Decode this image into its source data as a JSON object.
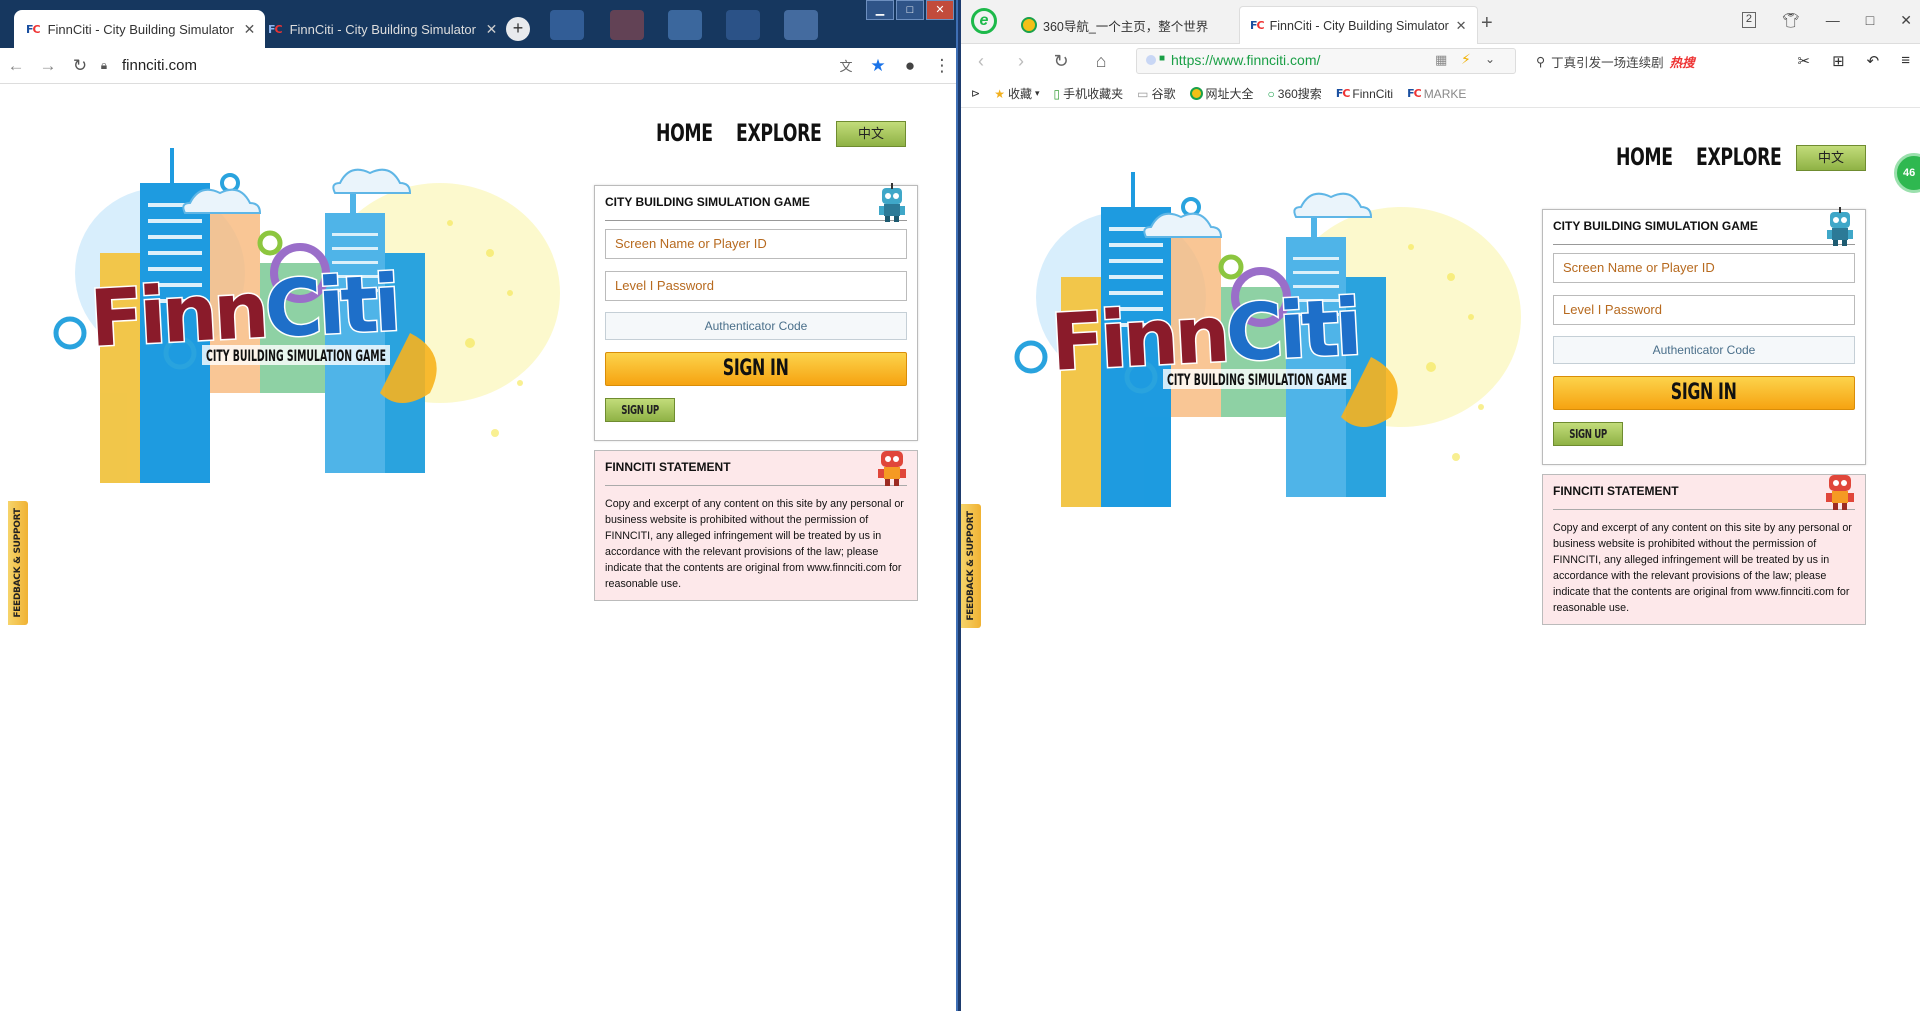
{
  "chrome": {
    "tab1_title": "FinnCiti - City Building Simulator",
    "tab2_title": "FinnCiti - City Building Simulator",
    "url": "finnciti.com",
    "new_tab": "+",
    "win_min": "▁",
    "win_max": "□",
    "win_close": "✕"
  },
  "browser360": {
    "tab1_title": "360导航_一个主页，整个世界",
    "tab2_title": "FinnCiti - City Building Simulator",
    "url": "https://www.finnciti.com/",
    "search_text": "丁真引发一场连续剧",
    "search_hot": "热搜",
    "tab_count": "2",
    "bookmarks": [
      "收藏",
      "手机收藏夹",
      "谷歌",
      "网址大全",
      "360搜索",
      "FinnCiti",
      "MARKE"
    ],
    "side_badge": "46"
  },
  "page": {
    "nav_home": "HOME",
    "nav_explore": "EXPLORE",
    "lang_button": "中文",
    "login_title": "CITY BUILDING SIMULATION GAME",
    "screen_name_placeholder": "Screen Name or Player ID",
    "password_placeholder": "Level I Password",
    "auth_placeholder": "Authenticator Code",
    "signin_label": "SIGN IN",
    "signup_label": "SIGN UP",
    "statement_title": "FINNCITI STATEMENT",
    "statement_text": "Copy and excerpt of any content on this site by any personal or business website is prohibited without the permission of FINNCITI, any alleged infringement will be treated by us in accordance with the relevant provisions of the law; please indicate that the contents are original from www.finnciti.com for reasonable use.",
    "feedback_label": "FEEDBACK & SUPPORT",
    "logo_word": "FinnCiti",
    "logo_tagline": "CITY BUILDING SIMULATION GAME"
  },
  "colors": {
    "signin_gold": "#f6a311",
    "green_button": "#8fb245",
    "statement_bg": "#fde8ea",
    "placeholder_orange": "#b76a1f",
    "chrome_frame": "#16375f",
    "browser360_green": "#1db94a"
  }
}
